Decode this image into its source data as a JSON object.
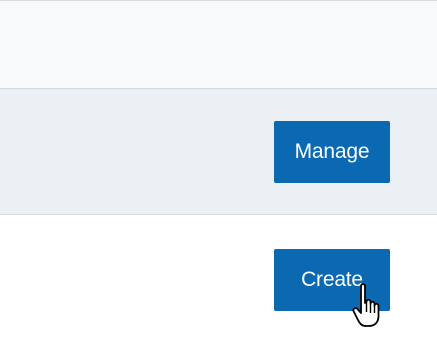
{
  "actions": {
    "manage_label": "Manage",
    "create_label": "Create"
  },
  "cursor": {
    "type": "hand-pointer-icon"
  },
  "colors": {
    "button_bg": "#0a69b0",
    "button_text": "#ffffff",
    "row_highlight": "#ebf0f5",
    "row_plain": "#f7f9fb"
  }
}
